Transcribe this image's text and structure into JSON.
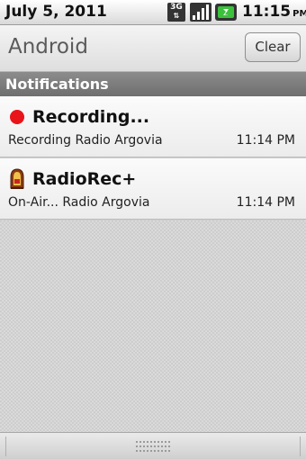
{
  "status_bar": {
    "date": "July 5, 2011",
    "time": "11:15",
    "ampm": "PM",
    "network_label": "3G",
    "icons": [
      "network-3g-icon",
      "signal-icon",
      "battery-icon"
    ]
  },
  "header": {
    "title": "Android",
    "clear_label": "Clear"
  },
  "section": {
    "label": "Notifications"
  },
  "notifications": [
    {
      "icon": "record-dot-icon",
      "title": "Recording...",
      "text": "Recording Radio Argovia",
      "time": "11:14 PM"
    },
    {
      "icon": "radio-app-icon",
      "title": "RadioRec+",
      "text": "On-Air... Radio Argovia",
      "time": "11:14 PM"
    }
  ],
  "colors": {
    "record_dot": "#e8141a",
    "section_bar": "#7d7d7d",
    "battery_green": "#3cc13c"
  }
}
